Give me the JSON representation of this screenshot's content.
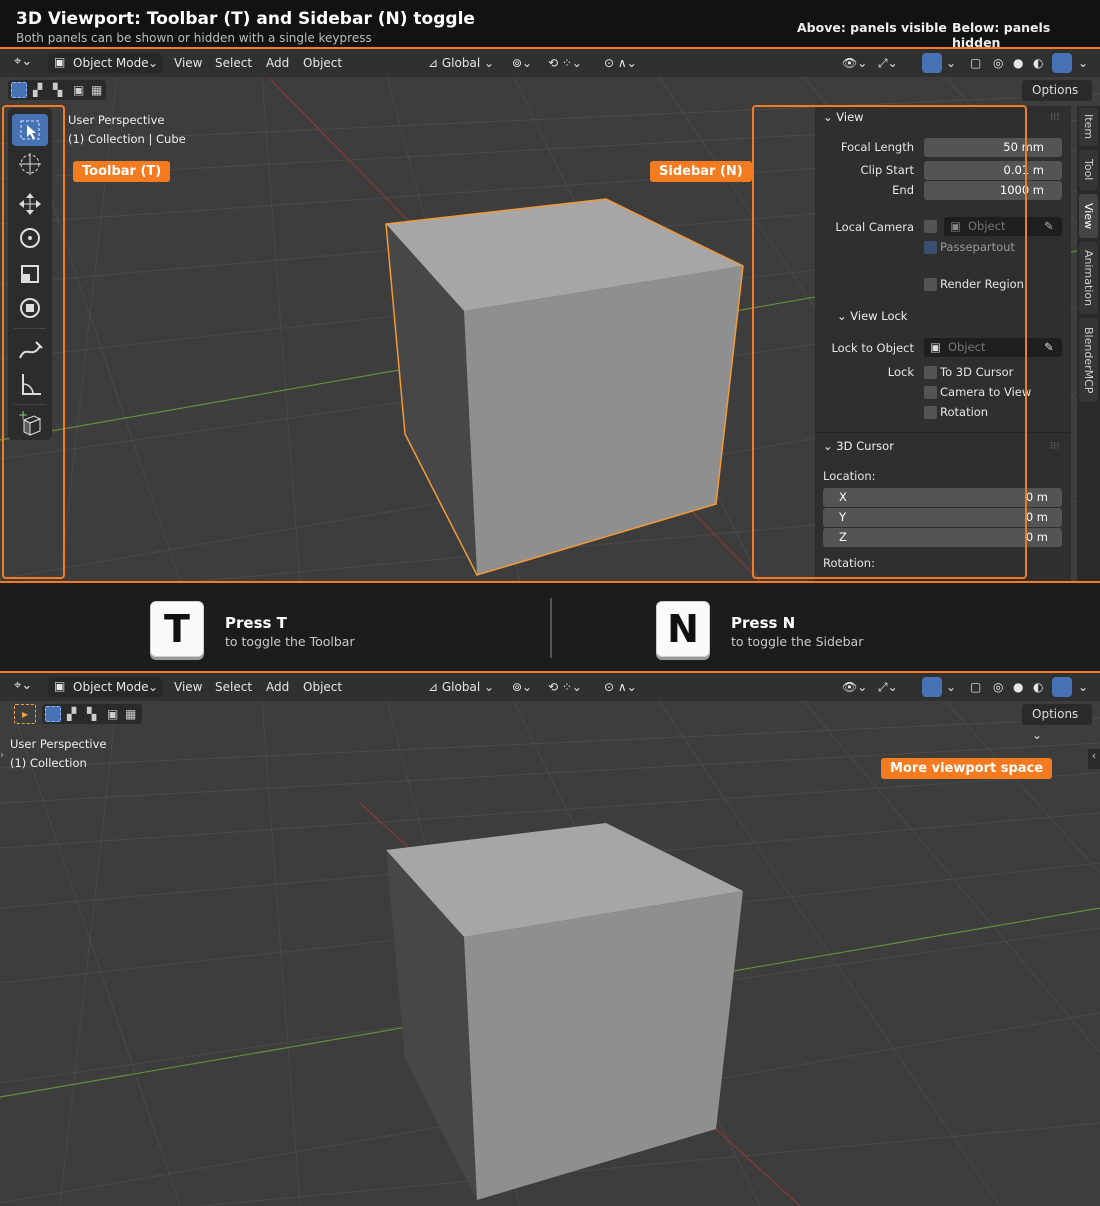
{
  "header": {
    "title": "3D Viewport: Toolbar (T) and Sidebar (N) toggle",
    "subtitle": "Both panels can be shown or hidden with a single keypress",
    "above_label": "Above: panels visible",
    "below_label": "Below: panels hidden"
  },
  "viewport_header": {
    "mode": "Object Mode",
    "menus": [
      "View",
      "Select",
      "Add",
      "Object"
    ],
    "orientation": "Global",
    "options_label": "Options"
  },
  "top_viewport": {
    "perspective": "User Perspective",
    "collection": "(1) Collection | Cube",
    "toolbar_callout": "Toolbar (T)",
    "sidebar_callout": "Sidebar (N)"
  },
  "sidebar": {
    "view_panel": {
      "title": "View",
      "focal_length_label": "Focal Length",
      "focal_length": "50 mm",
      "clip_start_label": "Clip Start",
      "clip_start": "0.01 m",
      "end_label": "End",
      "end": "1000 m",
      "local_camera_label": "Local Camera",
      "object_placeholder": "Object",
      "passepartout_label": "Passepartout",
      "render_region_label": "Render Region"
    },
    "view_lock": {
      "title": "View Lock",
      "lock_to_object_label": "Lock to Object",
      "object_placeholder": "Object",
      "lock_label": "Lock",
      "to_cursor_label": "To 3D Cursor",
      "camera_to_view_label": "Camera to View",
      "rotation_label": "Rotation"
    },
    "cursor_panel": {
      "title": "3D Cursor",
      "location_label": "Location:",
      "x_label": "X",
      "x_value": "0 m",
      "y_label": "Y",
      "y_value": "0 m",
      "z_label": "Z",
      "z_value": "0 m",
      "rotation_label": "Rotation:"
    },
    "tabs": [
      "Item",
      "Tool",
      "View",
      "Animation",
      "BlenderMCP"
    ],
    "active_tab": "View"
  },
  "keys": {
    "t_key": "T",
    "t_title": "Press T",
    "t_sub": "to toggle the Toolbar",
    "n_key": "N",
    "n_title": "Press N",
    "n_sub": "to toggle the Sidebar"
  },
  "bottom_viewport": {
    "perspective": "User Perspective",
    "collection": "(1) Collection",
    "space_callout": "More viewport space"
  },
  "colors": {
    "accent": "#f47b20",
    "active_blue": "#4772b3",
    "viewport_bg": "#3d3d3d"
  },
  "icons": [
    "select-box-icon",
    "cursor-icon",
    "move-icon",
    "rotate-icon",
    "scale-icon",
    "transform-icon",
    "annotate-icon",
    "measure-icon",
    "add-cube-icon"
  ]
}
